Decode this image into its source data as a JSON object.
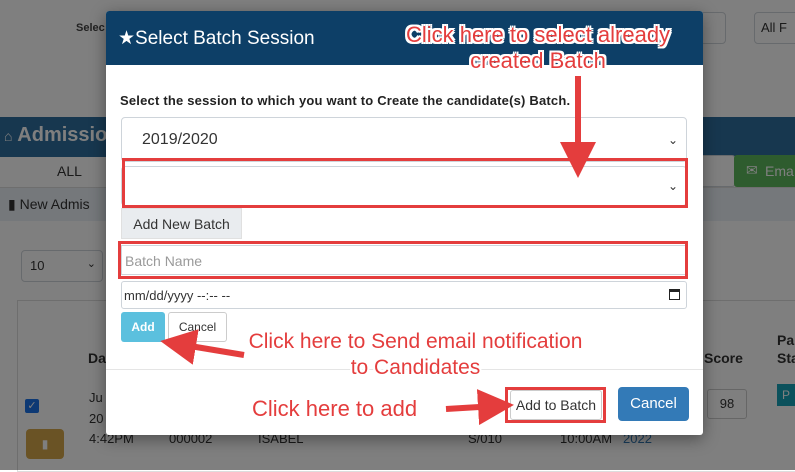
{
  "background": {
    "top_select_label": "Selec",
    "top_right_select": "All F",
    "header_title": "Admission",
    "tab_all": "ALL",
    "email_button": "Ema",
    "subbar_text": "New Admis",
    "page_size": "10",
    "col_date": "Da",
    "col_score": "Score",
    "col_pa": "Pa",
    "col_sta": "Sta",
    "row_date_1": "Ju",
    "row_date_2": "20",
    "row_time": "4:42PM",
    "row_id": "000002",
    "row_name": "ISABEL",
    "row_code": "S/010",
    "row_time2": "10:00AM",
    "row_year": "2022",
    "row_score": "98",
    "row_badge": "P"
  },
  "modal": {
    "title": "Select Batch Session",
    "subtitle": "Select the session to which you want to Create the candidate(s) Batch.",
    "session_value": "2019/2020",
    "batch_select_value": "",
    "add_new_batch_label": "Add New Batch",
    "batch_name_placeholder": "Batch Name",
    "date_placeholder": "mm/dd/yyyy --:-- --",
    "add_label": "Add",
    "cancel_small_label": "Cancel",
    "add_to_batch_label": "Add to Batch",
    "cancel_label": "Cancel"
  },
  "annotations": {
    "select_batch_line1": "Click here to select already",
    "select_batch_line2": "created Batch",
    "email_line1": "Click here to Send email notification",
    "email_line2": "to Candidates",
    "add_text": "Click here to add",
    "color": "#e43d3d"
  }
}
